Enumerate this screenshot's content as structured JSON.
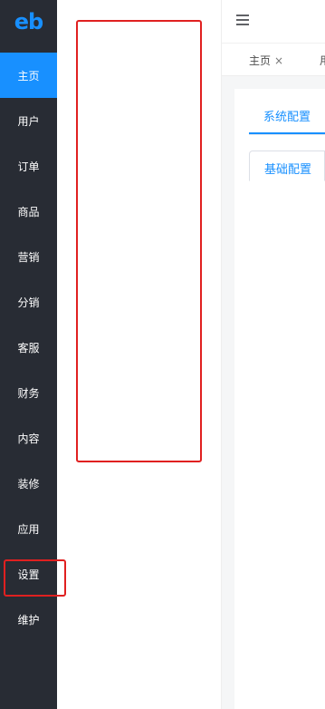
{
  "logo": {
    "text": "eb"
  },
  "sidebar": {
    "items": [
      {
        "label": "主页",
        "active": true
      },
      {
        "label": "用户"
      },
      {
        "label": "订单"
      },
      {
        "label": "商品"
      },
      {
        "label": "营销"
      },
      {
        "label": "分销"
      },
      {
        "label": "客服"
      },
      {
        "label": "财务"
      },
      {
        "label": "内容"
      },
      {
        "label": "装修"
      },
      {
        "label": "应用"
      },
      {
        "label": "设置"
      },
      {
        "label": "维护"
      }
    ]
  },
  "header": {
    "menu_icon": "hamburger-icon"
  },
  "tags": [
    {
      "label": "主页",
      "close": "×"
    },
    {
      "label": "用"
    }
  ],
  "main": {
    "tabs": [
      {
        "label": "系统配置"
      }
    ],
    "subtabs": [
      {
        "label": "基础配置"
      }
    ]
  },
  "colors": {
    "accent": "#1890ff",
    "sidebar_bg": "#282c34",
    "annotation": "#e02020"
  }
}
